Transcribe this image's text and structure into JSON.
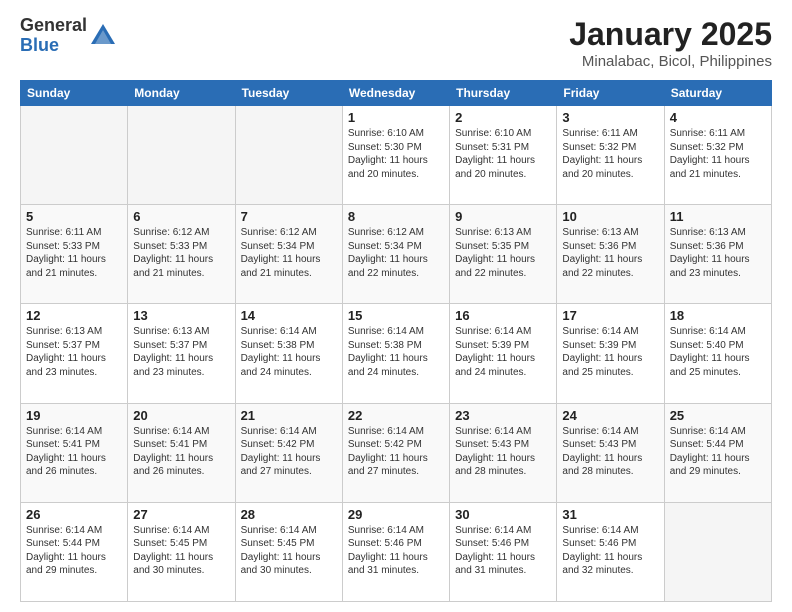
{
  "header": {
    "logo_general": "General",
    "logo_blue": "Blue",
    "month_title": "January 2025",
    "location": "Minalabac, Bicol, Philippines"
  },
  "weekdays": [
    "Sunday",
    "Monday",
    "Tuesday",
    "Wednesday",
    "Thursday",
    "Friday",
    "Saturday"
  ],
  "weeks": [
    [
      {
        "day": "",
        "info": ""
      },
      {
        "day": "",
        "info": ""
      },
      {
        "day": "",
        "info": ""
      },
      {
        "day": "1",
        "info": "Sunrise: 6:10 AM\nSunset: 5:30 PM\nDaylight: 11 hours\nand 20 minutes."
      },
      {
        "day": "2",
        "info": "Sunrise: 6:10 AM\nSunset: 5:31 PM\nDaylight: 11 hours\nand 20 minutes."
      },
      {
        "day": "3",
        "info": "Sunrise: 6:11 AM\nSunset: 5:32 PM\nDaylight: 11 hours\nand 20 minutes."
      },
      {
        "day": "4",
        "info": "Sunrise: 6:11 AM\nSunset: 5:32 PM\nDaylight: 11 hours\nand 21 minutes."
      }
    ],
    [
      {
        "day": "5",
        "info": "Sunrise: 6:11 AM\nSunset: 5:33 PM\nDaylight: 11 hours\nand 21 minutes."
      },
      {
        "day": "6",
        "info": "Sunrise: 6:12 AM\nSunset: 5:33 PM\nDaylight: 11 hours\nand 21 minutes."
      },
      {
        "day": "7",
        "info": "Sunrise: 6:12 AM\nSunset: 5:34 PM\nDaylight: 11 hours\nand 21 minutes."
      },
      {
        "day": "8",
        "info": "Sunrise: 6:12 AM\nSunset: 5:34 PM\nDaylight: 11 hours\nand 22 minutes."
      },
      {
        "day": "9",
        "info": "Sunrise: 6:13 AM\nSunset: 5:35 PM\nDaylight: 11 hours\nand 22 minutes."
      },
      {
        "day": "10",
        "info": "Sunrise: 6:13 AM\nSunset: 5:36 PM\nDaylight: 11 hours\nand 22 minutes."
      },
      {
        "day": "11",
        "info": "Sunrise: 6:13 AM\nSunset: 5:36 PM\nDaylight: 11 hours\nand 23 minutes."
      }
    ],
    [
      {
        "day": "12",
        "info": "Sunrise: 6:13 AM\nSunset: 5:37 PM\nDaylight: 11 hours\nand 23 minutes."
      },
      {
        "day": "13",
        "info": "Sunrise: 6:13 AM\nSunset: 5:37 PM\nDaylight: 11 hours\nand 23 minutes."
      },
      {
        "day": "14",
        "info": "Sunrise: 6:14 AM\nSunset: 5:38 PM\nDaylight: 11 hours\nand 24 minutes."
      },
      {
        "day": "15",
        "info": "Sunrise: 6:14 AM\nSunset: 5:38 PM\nDaylight: 11 hours\nand 24 minutes."
      },
      {
        "day": "16",
        "info": "Sunrise: 6:14 AM\nSunset: 5:39 PM\nDaylight: 11 hours\nand 24 minutes."
      },
      {
        "day": "17",
        "info": "Sunrise: 6:14 AM\nSunset: 5:39 PM\nDaylight: 11 hours\nand 25 minutes."
      },
      {
        "day": "18",
        "info": "Sunrise: 6:14 AM\nSunset: 5:40 PM\nDaylight: 11 hours\nand 25 minutes."
      }
    ],
    [
      {
        "day": "19",
        "info": "Sunrise: 6:14 AM\nSunset: 5:41 PM\nDaylight: 11 hours\nand 26 minutes."
      },
      {
        "day": "20",
        "info": "Sunrise: 6:14 AM\nSunset: 5:41 PM\nDaylight: 11 hours\nand 26 minutes."
      },
      {
        "day": "21",
        "info": "Sunrise: 6:14 AM\nSunset: 5:42 PM\nDaylight: 11 hours\nand 27 minutes."
      },
      {
        "day": "22",
        "info": "Sunrise: 6:14 AM\nSunset: 5:42 PM\nDaylight: 11 hours\nand 27 minutes."
      },
      {
        "day": "23",
        "info": "Sunrise: 6:14 AM\nSunset: 5:43 PM\nDaylight: 11 hours\nand 28 minutes."
      },
      {
        "day": "24",
        "info": "Sunrise: 6:14 AM\nSunset: 5:43 PM\nDaylight: 11 hours\nand 28 minutes."
      },
      {
        "day": "25",
        "info": "Sunrise: 6:14 AM\nSunset: 5:44 PM\nDaylight: 11 hours\nand 29 minutes."
      }
    ],
    [
      {
        "day": "26",
        "info": "Sunrise: 6:14 AM\nSunset: 5:44 PM\nDaylight: 11 hours\nand 29 minutes."
      },
      {
        "day": "27",
        "info": "Sunrise: 6:14 AM\nSunset: 5:45 PM\nDaylight: 11 hours\nand 30 minutes."
      },
      {
        "day": "28",
        "info": "Sunrise: 6:14 AM\nSunset: 5:45 PM\nDaylight: 11 hours\nand 30 minutes."
      },
      {
        "day": "29",
        "info": "Sunrise: 6:14 AM\nSunset: 5:46 PM\nDaylight: 11 hours\nand 31 minutes."
      },
      {
        "day": "30",
        "info": "Sunrise: 6:14 AM\nSunset: 5:46 PM\nDaylight: 11 hours\nand 31 minutes."
      },
      {
        "day": "31",
        "info": "Sunrise: 6:14 AM\nSunset: 5:46 PM\nDaylight: 11 hours\nand 32 minutes."
      },
      {
        "day": "",
        "info": ""
      }
    ]
  ]
}
